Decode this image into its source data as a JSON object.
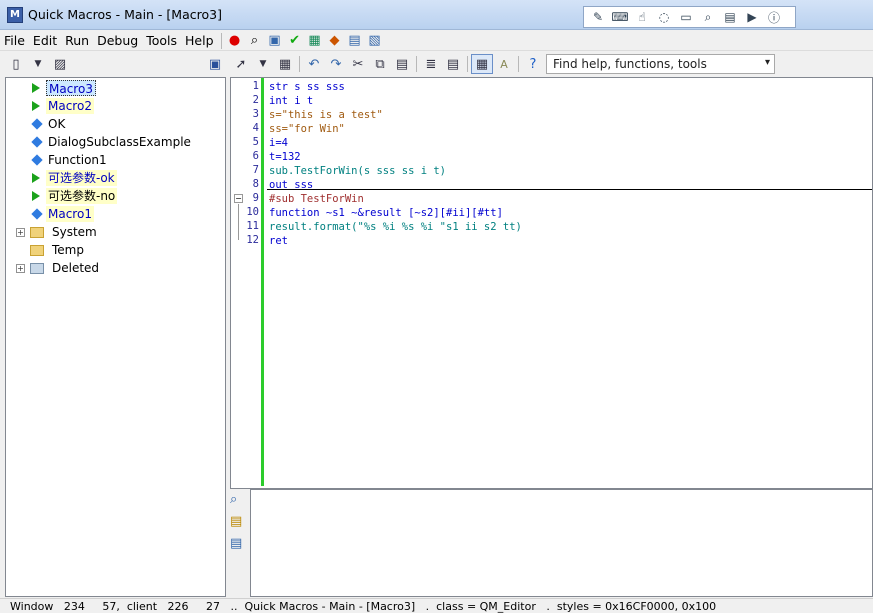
{
  "window": {
    "title": "Quick Macros - Main - [Macro3]",
    "app_icon_letter": "M"
  },
  "menu": [
    "File",
    "Edit",
    "Run",
    "Debug",
    "Tools",
    "Help"
  ],
  "search": {
    "placeholder": "Find help, functions, tools"
  },
  "tree": [
    {
      "label": "Macro3",
      "icon": "green-triangle",
      "selected": true
    },
    {
      "label": "Macro2",
      "icon": "green-triangle"
    },
    {
      "label": "OK",
      "icon": "blue-diamond"
    },
    {
      "label": "DialogSubclassExample",
      "icon": "blue-diamond"
    },
    {
      "label": "Function1",
      "icon": "blue-diamond"
    },
    {
      "label": "可选参数-ok",
      "icon": "green-triangle"
    },
    {
      "label": "可选参数-no",
      "icon": "green-triangle"
    },
    {
      "label": "Macro1",
      "icon": "blue-diamond"
    },
    {
      "label": "System",
      "icon": "folder"
    },
    {
      "label": "Temp",
      "icon": "folder"
    },
    {
      "label": "Deleted",
      "icon": "folder"
    }
  ],
  "code_lines": [
    {
      "n": "1",
      "text": "str s ss sss"
    },
    {
      "n": "2",
      "text": "int i t"
    },
    {
      "n": "3",
      "text": "s=\"this is a test\""
    },
    {
      "n": "4",
      "text": "ss=\"for Win\""
    },
    {
      "n": "5",
      "text": "i=4"
    },
    {
      "n": "6",
      "text": "t=132"
    },
    {
      "n": "7",
      "text": "sub.TestForWin(s sss ss i t)"
    },
    {
      "n": "8",
      "text": "out sss"
    },
    {
      "n": "9",
      "text": "#sub TestForWin"
    },
    {
      "n": "10",
      "text": "function ~s1 ~&result [~s2][#ii][#tt]"
    },
    {
      "n": "11",
      "text": "result.format(\"%s %i %s %i \"s1 ii s2 tt)"
    },
    {
      "n": "12",
      "text": "ret"
    }
  ],
  "status": {
    "text": "Window   234     57,  client   226     27   ..  Quick Macros - Main - [Macro3]   .  class = QM_Editor   .  styles = 0x16CF0000, 0x100"
  }
}
